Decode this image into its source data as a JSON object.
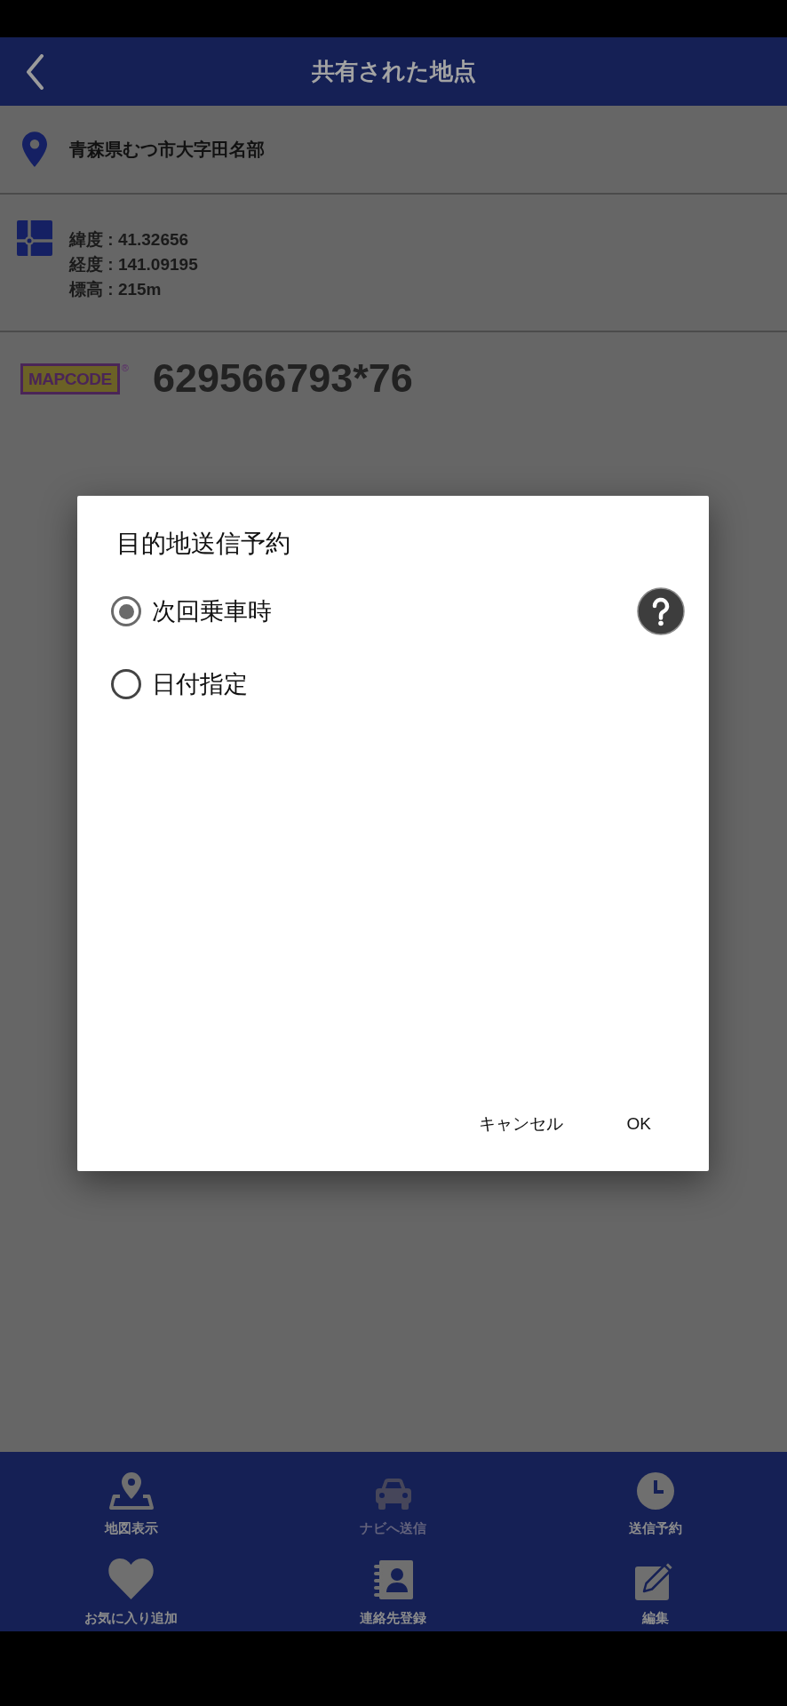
{
  "header": {
    "title": "共有された地点"
  },
  "address": {
    "text": "青森県むつ市大字田名部"
  },
  "coordinates": {
    "lines": [
      "緯度 : 41.32656",
      "経度 : 141.09195",
      "標高 : 215m"
    ]
  },
  "mapcode": {
    "logo": "MAPCODE",
    "registered_mark": "®",
    "code": "629566793*76"
  },
  "dialog": {
    "title": "目的地送信予約",
    "options": [
      {
        "label": "次回乗車時",
        "selected": true
      },
      {
        "label": "日付指定",
        "selected": false
      }
    ],
    "buttons": [
      "キャンセル",
      "OK"
    ]
  },
  "bottom_nav": [
    {
      "label": "地図表示",
      "disabled": false
    },
    {
      "label": "ナビへ送信",
      "disabled": true
    },
    {
      "label": "送信予約",
      "disabled": false
    },
    {
      "label": "お気に入り追加",
      "disabled": false
    },
    {
      "label": "連絡先登録",
      "disabled": false
    },
    {
      "label": "編集",
      "disabled": false
    }
  ]
}
